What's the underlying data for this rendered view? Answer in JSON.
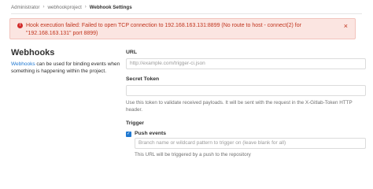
{
  "breadcrumb": {
    "items": [
      "Administrator",
      "webhookproject",
      "Webhook Settings"
    ],
    "separator": "›"
  },
  "alert": {
    "message": "Hook execution failed: Failed to open TCP connection to 192.168.163.131:8899 (No route to host - connect(2) for \"192.168.163.131\" port 8899)",
    "close_label": "×",
    "color": "#c0341d"
  },
  "sidebar": {
    "title": "Webhooks",
    "description_link": "Webhooks",
    "description_rest": " can be used for binding events when something is happening within the project."
  },
  "form": {
    "url": {
      "label": "URL",
      "placeholder": "http://example.com/trigger-ci.json"
    },
    "secret_token": {
      "label": "Secret Token",
      "value": "",
      "help": "Use this token to validate received payloads. It will be sent with the request in the X-Gitlab-Token HTTP header."
    },
    "trigger": {
      "label": "Trigger",
      "push_events": {
        "label": "Push events",
        "checked": true,
        "branch_placeholder": "Branch name or wildcard pattern to trigger on (leave blank for all)",
        "help": "This URL will be triggered by a push to the repository"
      }
    }
  },
  "colors": {
    "accent": "#1f78d1",
    "alert_background": "#fbe5e1"
  }
}
